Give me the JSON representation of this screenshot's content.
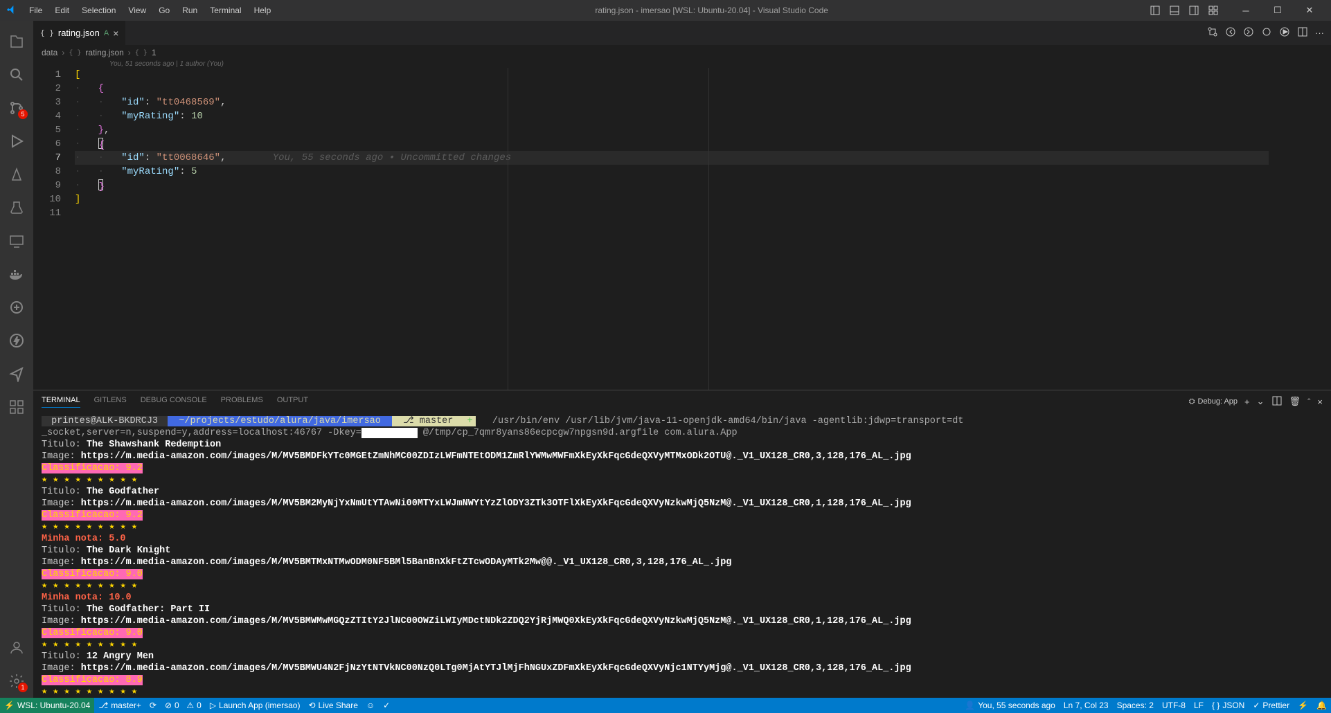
{
  "window": {
    "title": "rating.json - imersao [WSL: Ubuntu-20.04] - Visual Studio Code"
  },
  "menubar": [
    "File",
    "Edit",
    "Selection",
    "View",
    "Go",
    "Run",
    "Terminal",
    "Help"
  ],
  "activityBar": {
    "scm_badge": "5",
    "settings_badge": "1"
  },
  "tabs": {
    "active": {
      "label": "rating.json",
      "modified": "A"
    }
  },
  "breadcrumb": {
    "folder": "data",
    "file": "rating.json",
    "path": "1"
  },
  "gitlens_header": "You, 51 seconds ago | 1 author (You)",
  "code": {
    "lines": [
      "1",
      "2",
      "3",
      "4",
      "5",
      "6",
      "7",
      "8",
      "9",
      "10",
      "11"
    ],
    "current_line": "7",
    "id1_key": "\"id\"",
    "id1_val": "\"tt0468569\"",
    "rating_key": "\"myRating\"",
    "rating_val1": "10",
    "id2_val": "\"tt0068646\"",
    "rating_val2": "5",
    "inline_blame": "You, 55 seconds ago • Uncommitted changes"
  },
  "panel": {
    "tabs": [
      "TERMINAL",
      "GITLENS",
      "DEBUG CONSOLE",
      "PROBLEMS",
      "OUTPUT"
    ],
    "active_tab": "TERMINAL",
    "debug_label": "Debug: App"
  },
  "terminal": {
    "prompt_user": "printes@ALK-BKDRCJ3",
    "prompt_path": "~/projects/estudo/alura/java/imersao",
    "prompt_branch": "⎇ master",
    "cmd_line1": "/usr/bin/env /usr/lib/jvm/java-11-openjdk-amd64/bin/java -agentlib:jdwp=transport=dt",
    "cmd_line2_a": "_socket,server=n,suspend=y,address=localhost:46767 -Dkey=",
    "cmd_line2_b": " @/tmp/cp_7qmr8yans86ecpcgw7npgsn9d.argfile com.alura.App",
    "movies": [
      {
        "titulo_label": "Titulo:",
        "titulo": "The Shawshank Redemption",
        "image_label": "Image:",
        "image": "https://m.media-amazon.com/images/M/MV5BMDFkYTc0MGEtZmNhMC00ZDIzLWFmNTEtODM1ZmRlYWMwMWFmXkEyXkFqcGdeQXVyMTMxODk2OTU@._V1_UX128_CR0,3,128,176_AL_.jpg",
        "class": "Classificacao: 9.2",
        "stars": "★ ★ ★ ★ ★ ★ ★ ★ ★",
        "mynote": null
      },
      {
        "titulo_label": "Titulo:",
        "titulo": "The Godfather",
        "image_label": "Image:",
        "image": "https://m.media-amazon.com/images/M/MV5BM2MyNjYxNmUtYTAwNi00MTYxLWJmNWYtYzZlODY3ZTk3OTFlXkEyXkFqcGdeQXVyNzkwMjQ5NzM@._V1_UX128_CR0,1,128,176_AL_.jpg",
        "class": "Classificacao: 9.2",
        "stars": "★ ★ ★ ★ ★ ★ ★ ★ ★",
        "mynote": "Minha nota: 5.0"
      },
      {
        "titulo_label": "Titulo:",
        "titulo": "The Dark Knight",
        "image_label": "Image:",
        "image": "https://m.media-amazon.com/images/M/MV5BMTMxNTMwODM0NF5BMl5BanBnXkFtZTcwODAyMTk2Mw@@._V1_UX128_CR0,3,128,176_AL_.jpg",
        "class": "Classificacao: 9.0",
        "stars": "★ ★ ★ ★ ★ ★ ★ ★ ★",
        "mynote": "Minha nota: 10.0"
      },
      {
        "titulo_label": "Titulo:",
        "titulo": "The Godfather: Part II",
        "image_label": "Image:",
        "image": "https://m.media-amazon.com/images/M/MV5BMWMwMGQzZTItY2JlNC00OWZiLWIyMDctNDk2ZDQ2YjRjMWQ0XkEyXkFqcGdeQXVyNzkwMjQ5NzM@._V1_UX128_CR0,1,128,176_AL_.jpg",
        "class": "Classificacao: 9.0",
        "stars": "★ ★ ★ ★ ★ ★ ★ ★ ★",
        "mynote": null
      },
      {
        "titulo_label": "Titulo:",
        "titulo": "12 Angry Men",
        "image_label": "Image:",
        "image": "https://m.media-amazon.com/images/M/MV5BMWU4N2FjNzYtNTVkNC00NzQ0LTg0MjAtYTJlMjFhNGUxZDFmXkEyXkFqcGdeQXVyNjc1NTYyMjg@._V1_UX128_CR0,3,128,176_AL_.jpg",
        "class": "Classificacao: 8.9",
        "stars": "★ ★ ★ ★ ★ ★ ★ ★ ★",
        "mynote": null
      }
    ]
  },
  "statusbar": {
    "remote": "WSL: Ubuntu-20.04",
    "branch": "master+",
    "errors": "0",
    "warnings": "0",
    "launch": "Launch App (imersao)",
    "liveshare": "Live Share",
    "blame": "You, 55 seconds ago",
    "position": "Ln 7, Col 23",
    "spaces": "Spaces: 2",
    "encoding": "UTF-8",
    "eol": "LF",
    "lang": "JSON",
    "prettier": "Prettier"
  }
}
